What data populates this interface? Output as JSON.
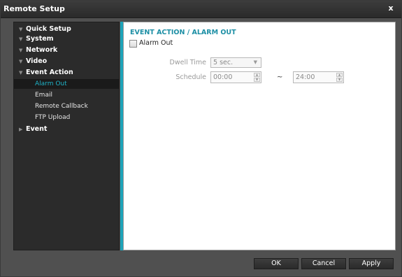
{
  "window": {
    "title": "Remote Setup",
    "close_label": "x"
  },
  "sidebar": {
    "items": [
      {
        "label": "Quick Setup",
        "expander": "▼"
      },
      {
        "label": "System",
        "expander": "▼"
      },
      {
        "label": "Network",
        "expander": "▼"
      },
      {
        "label": "Video",
        "expander": "▼"
      },
      {
        "label": "Event Action",
        "expander": "▼"
      },
      {
        "label": "Event",
        "expander": "▶"
      }
    ],
    "sub_items": [
      {
        "label": "Alarm Out",
        "selected": true
      },
      {
        "label": "Email",
        "selected": false
      },
      {
        "label": "Remote Callback",
        "selected": false
      },
      {
        "label": "FTP Upload",
        "selected": false
      }
    ]
  },
  "content": {
    "section_title": "EVENT ACTION / ALARM OUT",
    "alarm_out": {
      "label": "Alarm Out",
      "checked": false
    },
    "dwell_time": {
      "label": "Dwell Time",
      "value": "5 sec.",
      "arrow": "▼"
    },
    "schedule": {
      "label": "Schedule",
      "start": "00:00",
      "separator": "~",
      "end": "24:00",
      "up": "▲",
      "down": "▼"
    }
  },
  "buttons": {
    "ok": "OK",
    "cancel": "Cancel",
    "apply": "Apply"
  },
  "colors": {
    "accent": "#1da3b8",
    "active_text": "#1fb3c8",
    "section_title": "#1d8fa5"
  }
}
